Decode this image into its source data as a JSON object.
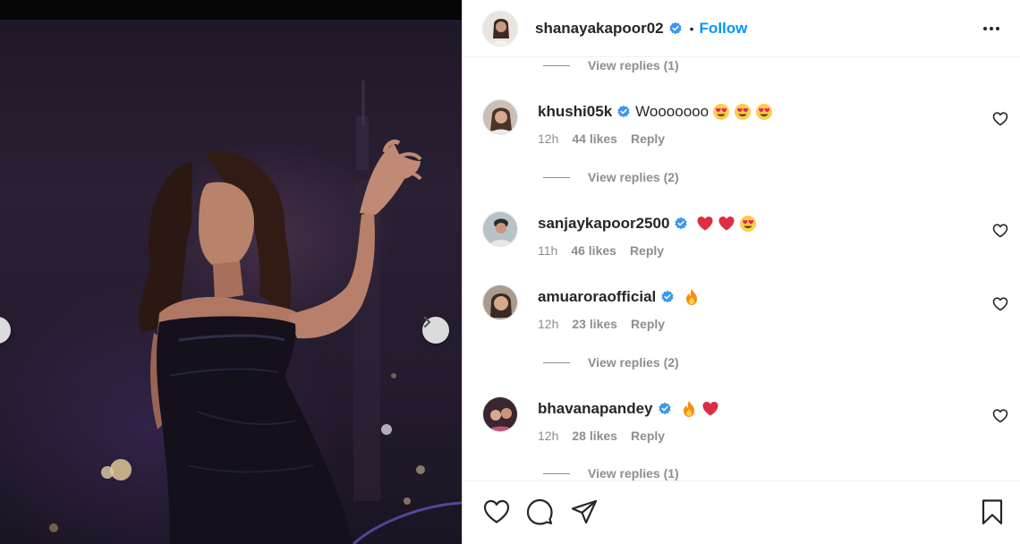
{
  "post": {
    "author": "shanayakapoor02",
    "separator": "•",
    "follow_label": "Follow",
    "more_icon": "more-horizontal-icon"
  },
  "comments": [
    {
      "type": "replies",
      "label": "View replies (1)"
    },
    {
      "type": "comment",
      "username": "khushi05k",
      "verified": true,
      "text": "Wooooooo",
      "emojis": [
        "heart-eyes",
        "heart-eyes",
        "heart-eyes"
      ],
      "time": "12h",
      "likes": "44 likes",
      "reply": "Reply"
    },
    {
      "type": "replies",
      "label": "View replies (2)"
    },
    {
      "type": "comment",
      "username": "sanjaykapoor2500",
      "verified": true,
      "text": "",
      "emojis": [
        "red-heart",
        "red-heart",
        "heart-eyes"
      ],
      "time": "11h",
      "likes": "46 likes",
      "reply": "Reply"
    },
    {
      "type": "comment",
      "username": "amuaroraofficial",
      "verified": true,
      "text": "",
      "emojis": [
        "fire"
      ],
      "time": "12h",
      "likes": "23 likes",
      "reply": "Reply"
    },
    {
      "type": "replies",
      "label": "View replies (2)"
    },
    {
      "type": "comment",
      "username": "bhavanapandey",
      "verified": true,
      "text": "",
      "emojis": [
        "fire",
        "red-heart"
      ],
      "time": "12h",
      "likes": "28 likes",
      "reply": "Reply"
    },
    {
      "type": "replies",
      "label": "View replies (1)"
    }
  ],
  "actions": {
    "like_icon": "heart-outline-icon",
    "comment_icon": "comment-bubble-icon",
    "share_icon": "paper-plane-icon",
    "save_icon": "bookmark-icon"
  },
  "colors": {
    "accent": "#0095f6",
    "verified": "#3897f0",
    "muted": "#8e8e8e",
    "text": "#262626"
  }
}
